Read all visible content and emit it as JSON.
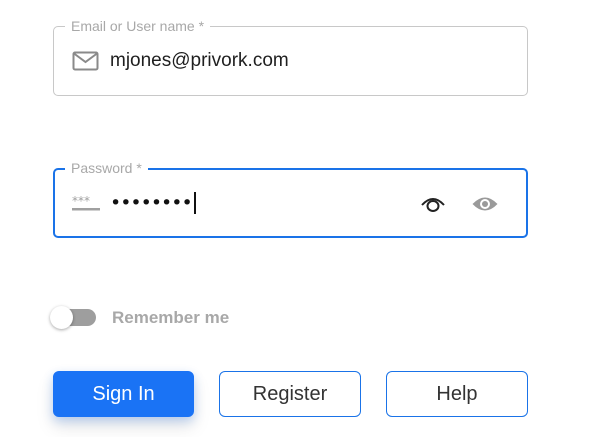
{
  "email_field": {
    "label": "Email or User name *",
    "value": "mjones@privork.com",
    "icon": "mail-icon"
  },
  "password_field": {
    "label": "Password *",
    "masked_value": "••••••••",
    "icon": "password-dots-icon",
    "trailing_icons": [
      "eye-closed-icon",
      "eye-icon"
    ],
    "focused": true
  },
  "remember_me": {
    "label": "Remember me",
    "checked": false
  },
  "buttons": {
    "sign_in": "Sign In",
    "register": "Register",
    "help": "Help"
  },
  "colors": {
    "accent": "#1a73f5",
    "focus_border": "#1a73e8",
    "muted_text": "#a8a8a8",
    "toggle_track": "#9e9e9e"
  }
}
